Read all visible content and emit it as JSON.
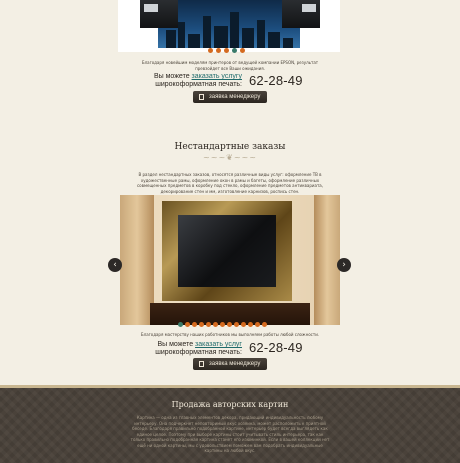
{
  "top_slider": {
    "caption": "Благодаря новейшим моделям принтеров от ведущей компании EPSON, результат превзойдет все Ваши ожидания.",
    "dots": 5,
    "active_dot": 4
  },
  "order_block_1": {
    "line1_prefix": "Вы можете",
    "link": "заказать услугу",
    "line2": "широкоформатная печать:",
    "phone": "62-28-49",
    "button": "заявка менеджеру"
  },
  "nonstandard": {
    "title": "Нестандартные заказы",
    "paragraph": "В раздел нестандартных заказов, относятся различные виды услуг: оформление ТВ в художественные рамы, оформление окон в рамы и багеты, оформление различных совмещенных предметов в коробку под стекло, оформление предметов антиквариата, декорирование стен и мм, изготовление карнизов, роспись стен.",
    "slider_caption": "Благодаря мастерству наших работников мы выполняем работы любой сложности.",
    "dots": 13,
    "active_dot": 0,
    "prev_arrow": "‹",
    "next_arrow": "›"
  },
  "order_block_2": {
    "line1_prefix": "Вы можете",
    "link": "заказать услуг",
    "line2": "широкоформатная печать:",
    "phone": "62-28-49",
    "button": "заявка менеджеру"
  },
  "paintings": {
    "title": "Продажа авторских картин",
    "paragraph": "Картина — одна из главных элементов декора, придающий индивидуальность любому интерьеру. Она подчеркнет неповторимый вкус хозяина, может расположить к приятной беседе. Благодаря правильно подобранной картине, интерьер будет всегда выглядеть как единое целое. Поэтому при выборе картины стоит учитывать стиль интерьера, так как только правильно подобранная картина станет его изюминкой. Если в вашей коллекции нет ещё ни одной картины, мы с удовольствием поможем вам подобрать индивидуальные картины на любой вкус."
  },
  "colors": {
    "background": "#f3efe4",
    "accent_orange": "#d46a1f",
    "accent_teal": "#3a7b6a",
    "button_dark": "#2b2620",
    "footer_dark": "#4a423a"
  }
}
